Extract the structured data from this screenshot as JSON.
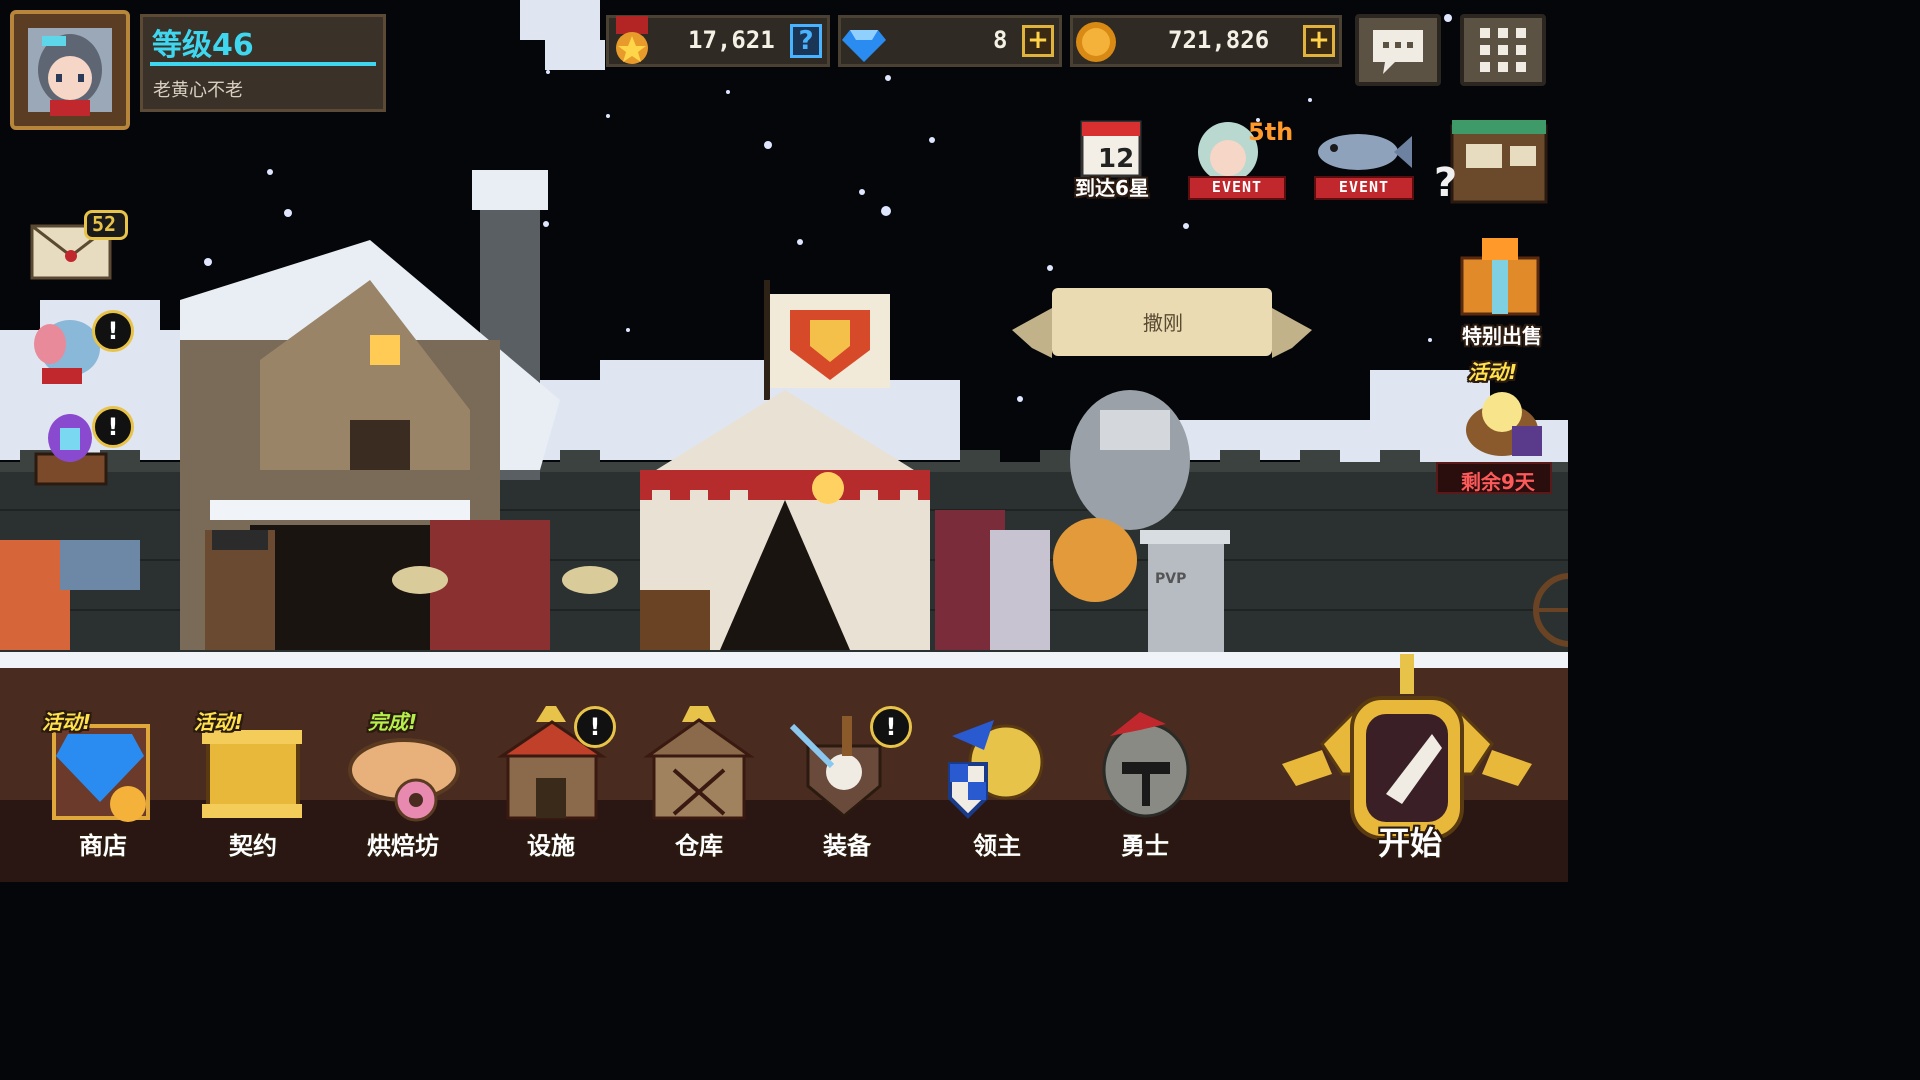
{
  "profile": {
    "level_text": "等级46",
    "player_name": "老黄心不老"
  },
  "currencies": {
    "medal_value": "17,621",
    "gem_value": "8",
    "gold_value": "721,826"
  },
  "top_right_buttons": {
    "chat_icon": "chat-bubble-icon",
    "menu_icon": "grid-menu-icon"
  },
  "events": {
    "calendar_day": "12",
    "calendar_label": "到达6星",
    "event1_ribbon": "EVENT",
    "event1_tag": "5th",
    "event2_ribbon": "EVENT"
  },
  "side_right": {
    "special_sale_label": "特别出售",
    "activity_tag": "活动!",
    "remaining_label": "剩余9天"
  },
  "side_left": {
    "mail_count": "52"
  },
  "banner": {
    "text": "撒刚"
  },
  "pvp_sign": "PVP",
  "menu": [
    {
      "label": "商店",
      "tag": "活动!"
    },
    {
      "label": "契约",
      "tag": "活动!"
    },
    {
      "label": "烘焙坊",
      "tag": "完成!"
    },
    {
      "label": "设施",
      "tag": ""
    },
    {
      "label": "仓库",
      "tag": ""
    },
    {
      "label": "装备",
      "tag": ""
    },
    {
      "label": "领主",
      "tag": ""
    },
    {
      "label": "勇士",
      "tag": ""
    }
  ],
  "start": {
    "label": "开始"
  },
  "colors": {
    "level_cyan": "#3fd6f0",
    "gold_accent": "#e0b43c",
    "event_red": "#c0282e",
    "ground": "#4a2b1f"
  }
}
